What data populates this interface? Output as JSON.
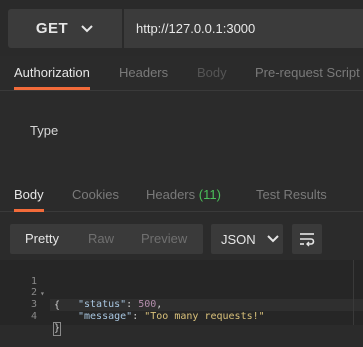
{
  "request": {
    "method": "GET",
    "url": "http://127.0.0.1:3000"
  },
  "request_tabs": [
    {
      "label": "Authorization",
      "state": "active"
    },
    {
      "label": "Headers",
      "state": "inactive"
    },
    {
      "label": "Body",
      "state": "disabled"
    },
    {
      "label": "Pre-request Script",
      "state": "inactive"
    }
  ],
  "auth": {
    "type_label": "Type"
  },
  "response_tabs": [
    {
      "label": "Body",
      "state": "active"
    },
    {
      "label": "Cookies",
      "state": "inactive"
    },
    {
      "label": "Headers",
      "badge": "(11)",
      "state": "inactive"
    },
    {
      "label": "Test Results",
      "state": "inactive"
    }
  ],
  "view_modes": [
    {
      "label": "Pretty",
      "selected": true
    },
    {
      "label": "Raw",
      "selected": false
    },
    {
      "label": "Preview",
      "selected": false
    }
  ],
  "format": {
    "selected": "JSON"
  },
  "icons": {
    "method_dropdown": "chevron-down-icon",
    "format_dropdown": "chevron-down-icon",
    "wrap_toggle": "wrap-lines-icon"
  },
  "colors": {
    "accent": "#f26b3a",
    "badge": "#4bbf5a"
  },
  "editor": {
    "line_numbers": [
      "1",
      "2",
      "3",
      "4"
    ],
    "lines": [
      {
        "open": "{"
      },
      {
        "key": "\"status\"",
        "sep": ": ",
        "value": "500",
        "tail": ","
      },
      {
        "key": "\"message\"",
        "sep": ": ",
        "value": "\"Too many requests!\""
      },
      {
        "close": "}"
      }
    ]
  }
}
